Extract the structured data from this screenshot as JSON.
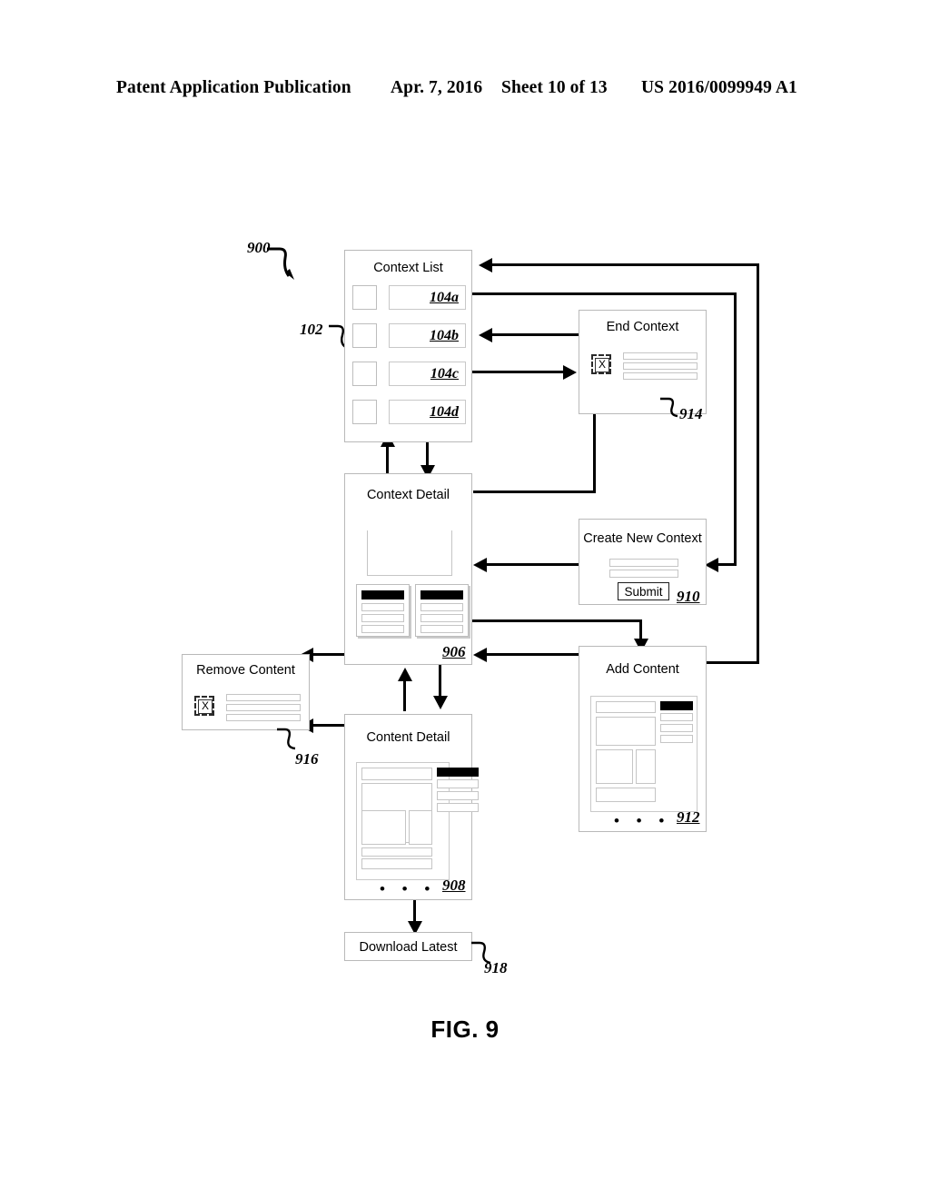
{
  "header": {
    "title": "Patent Application Publication",
    "date": "Apr. 7, 2016",
    "sheet": "Sheet 10 of 13",
    "patent_number": "US 2016/0099949 A1"
  },
  "figure": {
    "caption": "FIG. 9",
    "diagram_ref": "900",
    "context_list_ref": "102"
  },
  "panels": {
    "context_list": {
      "title": "Context List",
      "rows": [
        {
          "label": "104a"
        },
        {
          "label": "104b"
        },
        {
          "label": "104c"
        },
        {
          "label": "104d"
        }
      ]
    },
    "end_context": {
      "title": "End Context",
      "ref": "914",
      "close_label": "X",
      "bars": 3
    },
    "context_detail": {
      "title": "Context Detail",
      "ref": "906",
      "cards": 2,
      "card_rows": 3
    },
    "create_new_context": {
      "title": "Create New Context",
      "ref": "910",
      "submit_label": "Submit",
      "fields": 2
    },
    "remove_content": {
      "title": "Remove Content",
      "ref": "916",
      "close_label": "X",
      "bars": 3
    },
    "add_content": {
      "title": "Add Content",
      "ref": "912",
      "dots": "• • •"
    },
    "content_detail": {
      "title": "Content Detail",
      "ref": "908",
      "dots": "• • •"
    },
    "download_latest": {
      "title": "Download Latest",
      "ref": "918"
    }
  },
  "colors": {
    "line": "#000000",
    "panel_border": "#b9b9b9",
    "element_border": "#c5c5c5",
    "fill": "#ffffff"
  }
}
